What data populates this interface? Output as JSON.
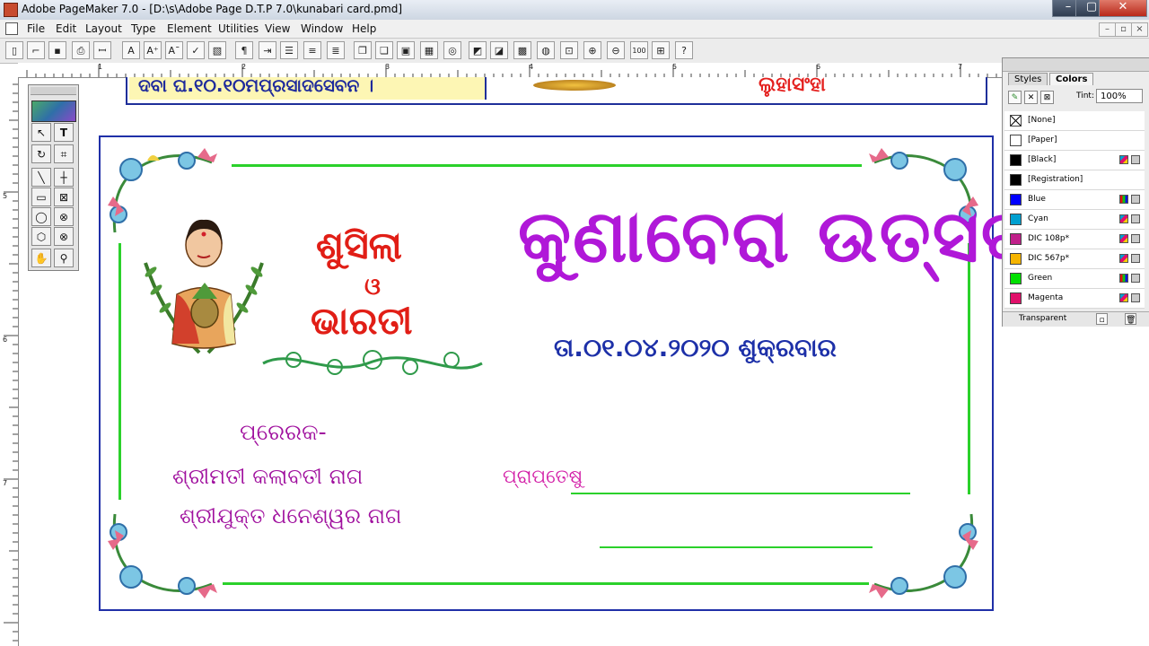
{
  "window": {
    "title": "Adobe PageMaker 7.0 - [D:\\s\\Adobe Page D.T.P 7.0\\kunabari card.pmd]",
    "minimize": "–",
    "maximize": "▢",
    "close": "✕"
  },
  "menu": {
    "items": [
      "File",
      "Edit",
      "Layout",
      "Type",
      "Element",
      "Utilities",
      "View",
      "Window",
      "Help"
    ]
  },
  "rulers": {
    "h": [
      "1",
      "2",
      "3",
      "4",
      "5",
      "6",
      "7"
    ],
    "v": [
      "5",
      "6",
      "7"
    ]
  },
  "prev_card": {
    "line1": "ଦବା ଘ.୧୦.୧୦ମପ୍ରସାଦସେବନ ।",
    "line2": "ଲୁହାସଂହା"
  },
  "card": {
    "title": "କୁଣାବେରା ଉତ୍ସବ",
    "name1": "ଶୁସିଲା",
    "and": "ଓ",
    "name2": "ଭାରତୀ",
    "date": "ତା.୦୧.୦୪.୨୦୨୦ ଶୁକ୍ରବାର",
    "sender_label": "ପ୍ରେରକ-",
    "sender_1": "ଶ୍ରୀମତୀ କଲାବତୀ ନାଗ",
    "sender_2": "ଶ୍ରୀଯୁକ୍ତ ଧନେଶ୍ୱର ନାଗ",
    "recipient_label": "ପ୍ରାପ୍ତେଷୁ"
  },
  "palette": {
    "tabs": [
      "Styles",
      "Colors"
    ],
    "active_tab": "Colors",
    "tint_label": "Tint:",
    "tint_value": "100%",
    "swatches": [
      {
        "name": "[None]",
        "color": "#ffffff"
      },
      {
        "name": "[Paper]",
        "color": "#ffffff"
      },
      {
        "name": "[Black]",
        "color": "#000000"
      },
      {
        "name": "[Registration]",
        "color": "#000000"
      },
      {
        "name": "Blue",
        "color": "#0000ff"
      },
      {
        "name": "Cyan",
        "color": "#00a0d0"
      },
      {
        "name": "DIC 108p*",
        "color": "#c0208a"
      },
      {
        "name": "DIC 567p*",
        "color": "#f5b400"
      },
      {
        "name": "Green",
        "color": "#00e000"
      },
      {
        "name": "Magenta",
        "color": "#e0106a"
      }
    ],
    "transparent_label": "Transparent"
  },
  "colors": {
    "border_blue": "#2030a8",
    "line_green": "#2bd12b",
    "title_purple": "#b018d8",
    "name_red": "#e11e16"
  }
}
